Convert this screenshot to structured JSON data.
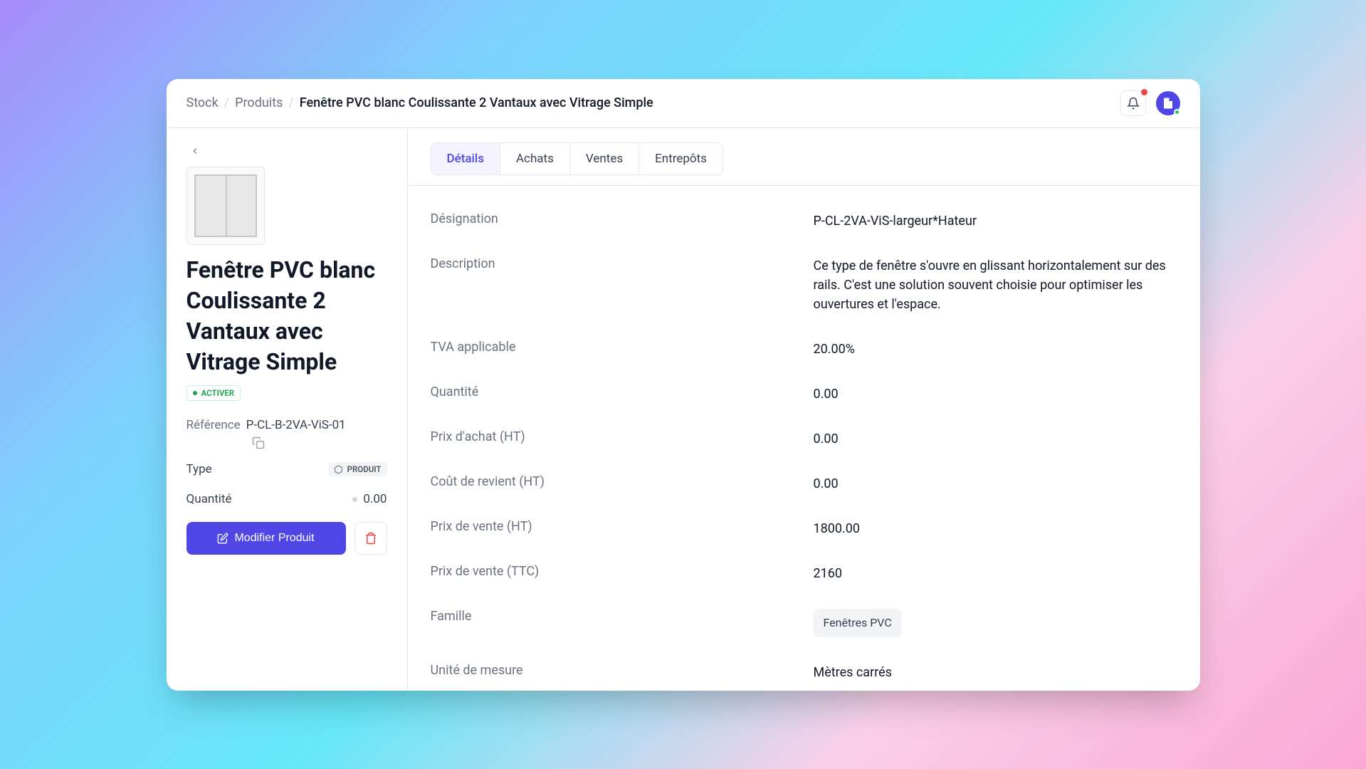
{
  "breadcrumb": {
    "root": "Stock",
    "section": "Produits",
    "current": "Fenêtre PVC blanc Coulissante 2 Vantaux avec Vitrage Simple"
  },
  "sidebar": {
    "title": "Fenêtre PVC blanc Coulissante 2 Vantaux avec Vitrage Simple",
    "status_label": "ACTIVER",
    "reference_label": "Référence",
    "reference_value": "P-CL-B-2VA-ViS-01",
    "type_label": "Type",
    "type_badge": "PRODUIT",
    "quantity_label": "Quantité",
    "quantity_value": "0.00",
    "modify_button": "Modifier Produit"
  },
  "tabs": {
    "details": "Détails",
    "achats": "Achats",
    "ventes": "Ventes",
    "entrepots": "Entrepôts"
  },
  "details": {
    "designation_label": "Désignation",
    "designation_value": "P-CL-2VA-ViS-largeur*Hateur",
    "description_label": "Description",
    "description_value": "Ce type de fenêtre s'ouvre en glissant horizontalement sur des rails. C'est une solution souvent choisie pour optimiser les ouvertures et l'espace.",
    "tva_label": "TVA applicable",
    "tva_value": "20.00%",
    "quantity_label": "Quantité",
    "quantity_value": "0.00",
    "purchase_price_label": "Prix d'achat (HT)",
    "purchase_price_value": "0.00",
    "cost_price_label": "Coût de revient (HT)",
    "cost_price_value": "0.00",
    "sale_price_ht_label": "Prix de vente (HT)",
    "sale_price_ht_value": "1800.00",
    "sale_price_ttc_label": "Prix de vente (TTC)",
    "sale_price_ttc_value": "2160",
    "family_label": "Famille",
    "family_value": "Fenêtres PVC",
    "unit_label": "Unité de mesure",
    "unit_value": "Mètres carrés"
  }
}
